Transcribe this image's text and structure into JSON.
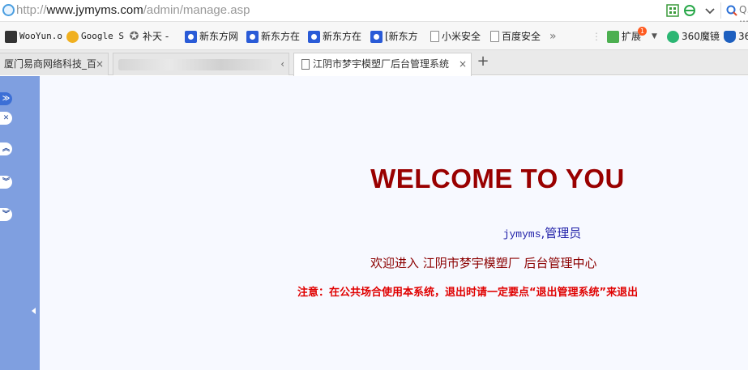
{
  "address_bar": {
    "url_prefix": "http://",
    "url_host": "www.jymyms.com",
    "url_path": "/admin/manage.asp",
    "search_fragment": "Q. ⋯"
  },
  "bookmarks": {
    "items": [
      {
        "label": "WooYun.o",
        "icon": "wooyun-icon"
      },
      {
        "label": "Google S",
        "icon": "google-bookmark-icon"
      },
      {
        "label": "补天 -",
        "icon": "star-icon"
      },
      {
        "label": "新东方网",
        "icon": "paw-icon"
      },
      {
        "label": "新东方在",
        "icon": "paw-icon"
      },
      {
        "label": "新东方在",
        "icon": "paw-icon"
      },
      {
        "label": "[新东方",
        "icon": "paw-icon"
      },
      {
        "label": "小米安全",
        "icon": "page-icon"
      },
      {
        "label": "百度安全",
        "icon": "page-icon"
      }
    ],
    "more": "»",
    "extensions_label": "扩展",
    "extensions_badge": "1",
    "magic_label": "360魔镜",
    "shield_label": "36"
  },
  "tabs": [
    {
      "title": "厦门易商网络科技_百",
      "close": "×"
    },
    {
      "title": "",
      "close": "‹"
    },
    {
      "title": "江阴市梦宇模塑厂后台管理系统",
      "close": "×"
    }
  ],
  "new_tab": "+",
  "main": {
    "welcome": "WELCOME TO YOU",
    "username": "jymyms",
    "role": ",管理员",
    "welcome_line": "欢迎进入 江阴市梦宇模塑厂  后台管理中心",
    "notice": "注意：在公共场合使用本系统，退出时请一定要点“退出管理系统”来退出"
  },
  "colors": {
    "welcome": "#990000",
    "notice": "#e00000",
    "left_frame": "#7f9fe0",
    "main_bg": "#f7f9ff"
  }
}
